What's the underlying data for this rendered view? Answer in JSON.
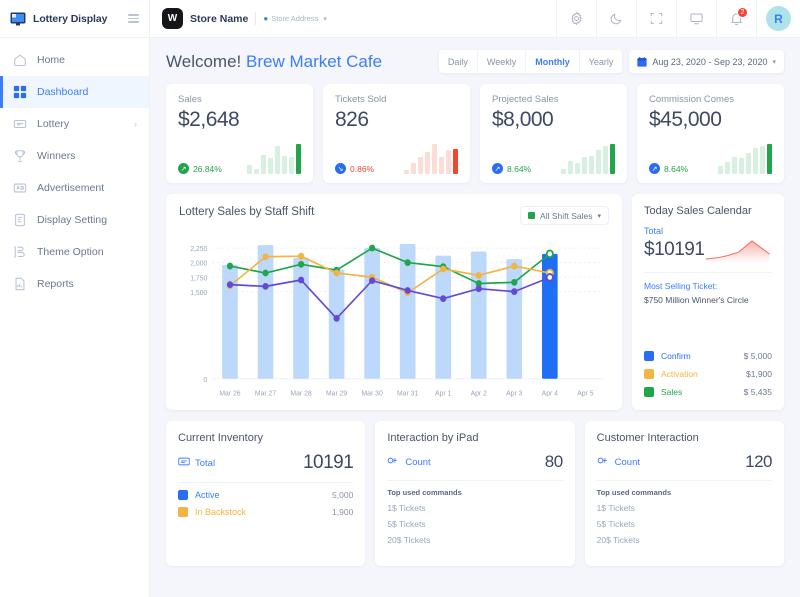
{
  "sidebar": {
    "brand": "Lottery Display",
    "items": [
      {
        "label": "Home",
        "icon": "home-icon",
        "active": false
      },
      {
        "label": "Dashboard",
        "icon": "grid-icon",
        "active": true
      },
      {
        "label": "Lottery",
        "icon": "ticket-icon",
        "active": false,
        "caret": "›"
      },
      {
        "label": "Winners",
        "icon": "trophy-icon",
        "active": false
      },
      {
        "label": "Advertisement",
        "icon": "ad-icon",
        "active": false
      },
      {
        "label": "Display Setting",
        "icon": "display-setting-icon",
        "active": false
      },
      {
        "label": "Theme Option",
        "icon": "theme-option-icon",
        "active": false
      },
      {
        "label": "Reports",
        "icon": "report-icon",
        "active": false
      }
    ]
  },
  "topbar": {
    "store_initial": "W",
    "store_name": "Store Name",
    "store_address": "Store Address",
    "icons": [
      "gear-icon",
      "moon-icon",
      "fullscreen-icon",
      "monitor-icon",
      "bell-icon"
    ],
    "notification_count": "2",
    "avatar_initial": "R"
  },
  "welcome": {
    "greeting": "Welcome!",
    "store": "Brew Market Cafe",
    "ranges": [
      "Daily",
      "Weekly",
      "Monthly",
      "Yearly"
    ],
    "active_range": "Monthly",
    "date_range": "Aug 23, 2020 - Sep 23, 2020"
  },
  "stats": [
    {
      "label": "Sales",
      "value": "$2,648",
      "trend": "26.84%",
      "trend_dir": "up",
      "trend_color": "#22a44b",
      "trend_text_color": "#22a44b",
      "bar_color": "#22a44b",
      "bar_faded": "#d8f0e0",
      "bars": [
        18,
        10,
        40,
        34,
        58,
        38,
        36,
        62
      ]
    },
    {
      "label": "Tickets Sold",
      "value": "826",
      "trend": "0.86%",
      "trend_dir": "down",
      "trend_color": "#2a6df5",
      "trend_text_color": "#f0472e",
      "bar_color": "#f0472e",
      "bar_faded": "#fbdcd7",
      "bars": [
        10,
        30,
        48,
        62,
        84,
        48,
        68,
        70
      ]
    },
    {
      "label": "Projected Sales",
      "value": "$8,000",
      "trend": "8.64%",
      "trend_dir": "up",
      "trend_color": "#2a6df5",
      "trend_text_color": "#22a44b",
      "bar_color": "#22a44b",
      "bar_faded": "#d8f0e0",
      "bars": [
        12,
        34,
        28,
        44,
        48,
        62,
        72,
        78
      ]
    },
    {
      "label": "Commission Comes",
      "value": "$45,000",
      "trend": "8.64%",
      "trend_dir": "up",
      "trend_color": "#2a6df5",
      "trend_text_color": "#22a44b",
      "bar_color": "#22a44b",
      "bar_faded": "#d8f0e0",
      "bars": [
        22,
        32,
        44,
        42,
        54,
        68,
        72,
        78
      ]
    }
  ],
  "chart": {
    "title": "Lottery Sales by Staff Shift",
    "select_label": "All Shift Sales",
    "select_color": "#22a44b"
  },
  "chart_data": {
    "type": "line",
    "title": "Lottery Sales by Staff Shift",
    "xlabel": "",
    "ylabel": "",
    "ylim": [
      0,
      2400
    ],
    "yticks": [
      0,
      1500,
      1750,
      2000,
      2250
    ],
    "ytick_labels": [
      "0",
      "1,500",
      "1,750",
      "2,000",
      "2,250"
    ],
    "grid": true,
    "legend": "none",
    "categories": [
      "Mar 26",
      "Mar 27",
      "Mar 28",
      "Mar 29",
      "Mar 30",
      "Mar 31",
      "Apr 1",
      "Apr 2",
      "Apr 3",
      "Apr 4",
      "Apr 5"
    ],
    "bars": {
      "name": "Total Sales",
      "color": "#bcd8fb",
      "highlight_color": "#1f6ef5",
      "highlight_index": 9,
      "values": [
        1960,
        2300,
        2080,
        1880,
        2250,
        2320,
        2120,
        2190,
        2060,
        2150,
        null
      ]
    },
    "series": [
      {
        "name": "Sales",
        "color": "#21a64a",
        "values": [
          1940,
          1820,
          1970,
          1870,
          2250,
          2000,
          1930,
          1640,
          1660,
          2150,
          null
        ]
      },
      {
        "name": "Activation",
        "color": "#f5b342",
        "values": [
          1600,
          2100,
          2110,
          1820,
          1750,
          1480,
          1890,
          1780,
          1940,
          1820,
          null
        ]
      },
      {
        "name": "Confirm",
        "color": "#6449d6",
        "values": [
          1620,
          1590,
          1700,
          1040,
          1690,
          1520,
          1380,
          1550,
          1500,
          1745,
          null
        ]
      }
    ]
  },
  "calendar": {
    "title": "Today Sales Calendar",
    "total_label": "Total",
    "total_value": "$10191",
    "most_selling_label": "Most Selling Ticket:",
    "most_selling_value": "$750 Million Winner's Circle",
    "legend": [
      {
        "label": "Confirm",
        "amount": "$ 5,000",
        "color": "#2a6df5"
      },
      {
        "label": "Activation",
        "amount": "$1,900",
        "color": "#f5b342"
      },
      {
        "label": "Sales",
        "amount": "$ 5,435",
        "color": "#21a64a"
      }
    ]
  },
  "inventory": {
    "title": "Current Inventory",
    "total_label": "Total",
    "total_value": "10191",
    "rows": [
      {
        "label": "Active",
        "amount": "5,000",
        "color": "#2a6df5"
      },
      {
        "label": "In Backstock",
        "amount": "1,900",
        "color": "#f5b342"
      }
    ]
  },
  "ipad": {
    "title": "Interaction by iPad",
    "count_label": "Count",
    "count_value": "80",
    "sub_title": "Top used commands",
    "commands": [
      "1$ Tickets",
      "5$ Tickets",
      "20$ Tickets"
    ]
  },
  "customer": {
    "title": "Customer Interaction",
    "count_label": "Count",
    "count_value": "120",
    "sub_title": "Top used commands",
    "commands": [
      "1$ Tickets",
      "5$ Tickets",
      "20$ Tickets"
    ]
  }
}
